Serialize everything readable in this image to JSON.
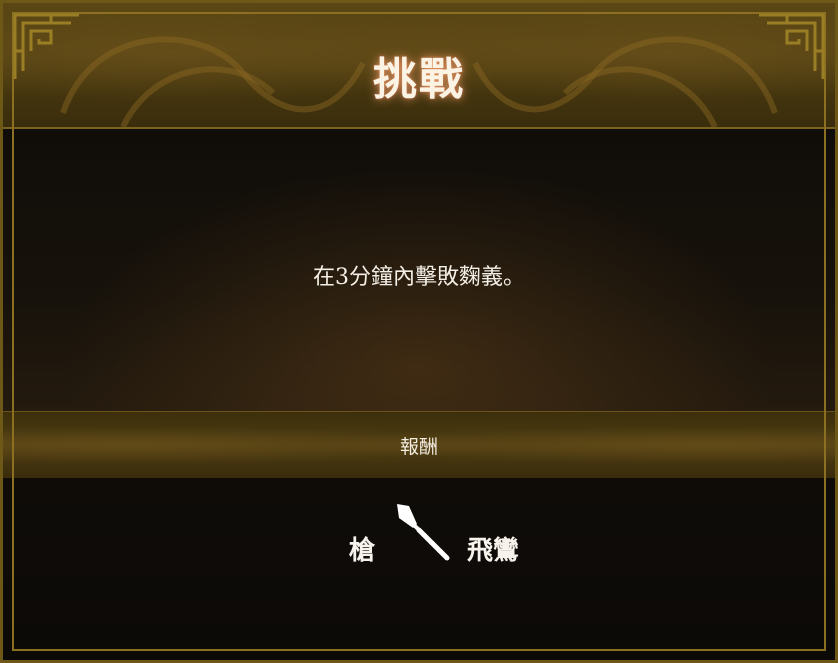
{
  "dialog": {
    "title": "挑戰",
    "challenge_text": "在3分鐘內擊敗麴義。",
    "rewards_label": "報酬",
    "reward": {
      "type": "槍",
      "icon": "spear-icon",
      "name": "飛鸞"
    }
  },
  "colors": {
    "frame_gold": "#8a7020",
    "header_bg": "#4a3a10",
    "body_bg": "#120e09",
    "title_glow": "#ffaa78",
    "text": "#f4efe6"
  }
}
